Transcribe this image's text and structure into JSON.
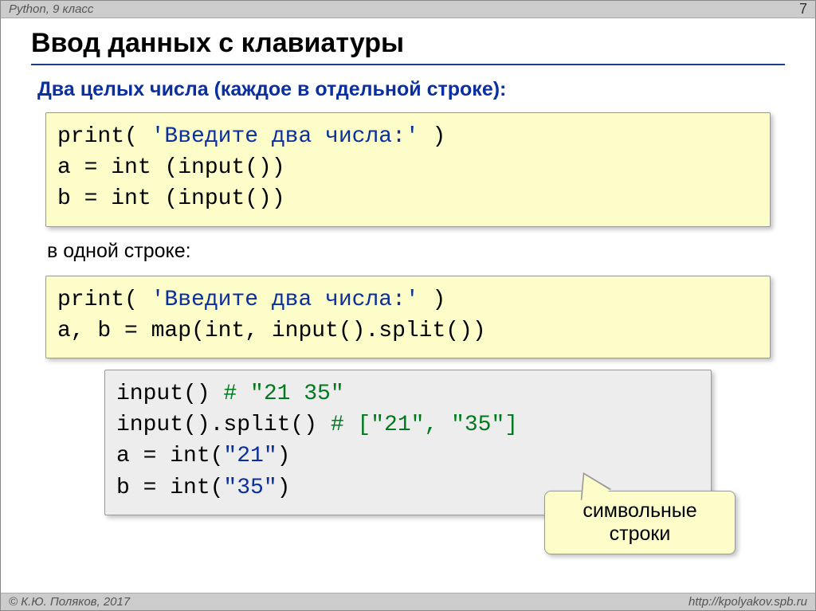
{
  "header": {
    "left": "Python, 9 класс",
    "page": "7"
  },
  "title": "Ввод данных с клавиатуры",
  "subtitle": "Два целых числа (каждое в отдельной строке):",
  "code1": {
    "l1a": "print( ",
    "l1b": "'Введите два числа:'",
    "l1c": " )",
    "l2": "a = int (input())",
    "l3": "b = int (input())"
  },
  "note": "в одной строке:",
  "code2": {
    "l1a": "print( ",
    "l1b": "'Введите два числа:'",
    "l1c": " )",
    "l2": "a, b = map(int, input().split())"
  },
  "code3": {
    "l1a": "input()          ",
    "l1b": "# \"21 35\"",
    "l2a": "input().split()  ",
    "l2b": "# [\"21\", \"35\"]",
    "l3a": "a = int(",
    "l3b": "\"21\"",
    "l3c": ")",
    "l4a": "b = int(",
    "l4b": "\"35\"",
    "l4c": ")"
  },
  "callout": {
    "l1": "символьные",
    "l2": "строки"
  },
  "footer": {
    "left": "© К.Ю. Поляков, 2017",
    "right": "http://kpolyakov.spb.ru"
  }
}
